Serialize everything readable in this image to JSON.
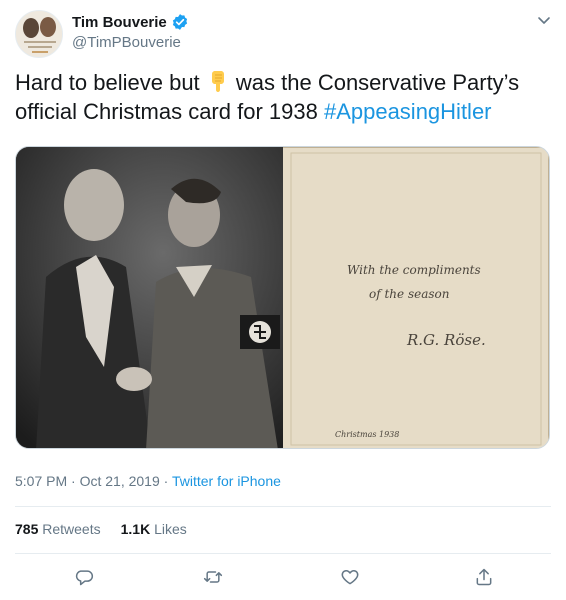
{
  "author": {
    "display_name": "Tim Bouverie",
    "handle": "@TimPBouverie",
    "verified": true
  },
  "tweet": {
    "text_before_emoji": "Hard to believe but ",
    "emoji": "backhand-index-pointing-down",
    "text_after_emoji": " was the Conservative Party’s official Christmas card for 1938 ",
    "hashtag": "#AppeasingHitler"
  },
  "media": {
    "card_lines": [
      "With the compliments",
      "of the season",
      "R.G. Röse.",
      "Christmas 1938"
    ]
  },
  "meta": {
    "time": "5:07 PM",
    "separator": " · ",
    "date": "Oct 21, 2019",
    "source": "Twitter for iPhone"
  },
  "stats": {
    "retweets_count": "785",
    "retweets_label": "Retweets",
    "likes_count": "1.1K",
    "likes_label": "Likes"
  },
  "icons": {
    "reply": "reply-icon",
    "retweet": "retweet-icon",
    "like": "heart-icon",
    "share": "share-icon",
    "menu": "chevron-down-icon"
  },
  "colors": {
    "link": "#1b95e0",
    "verified": "#1da1f2",
    "muted": "#657786",
    "text": "#14171a"
  }
}
